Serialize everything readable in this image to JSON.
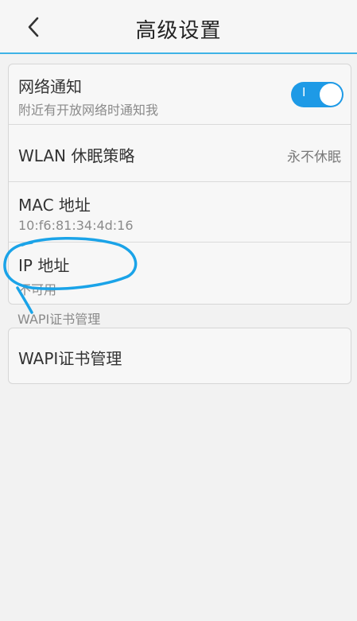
{
  "header": {
    "title": "高级设置",
    "back_icon": "chevron-left-icon"
  },
  "settings": {
    "network_notify": {
      "title": "网络通知",
      "subtitle": "附近有开放网络时通知我",
      "toggle_text": "I",
      "toggle_on": true
    },
    "wlan_sleep": {
      "title": "WLAN 休眠策略",
      "value": "永不休眠"
    },
    "mac": {
      "title": "MAC 地址",
      "value": "10:f6:81:34:4d:16"
    },
    "ip": {
      "title": "IP 地址",
      "value": "不可用"
    }
  },
  "wapi": {
    "section_label": "WAPI证书管理",
    "item_title": "WAPI证书管理"
  },
  "colors": {
    "accent": "#3fb3e6",
    "toggle": "#1e9ae6",
    "annotation": "#1aa3e8"
  }
}
